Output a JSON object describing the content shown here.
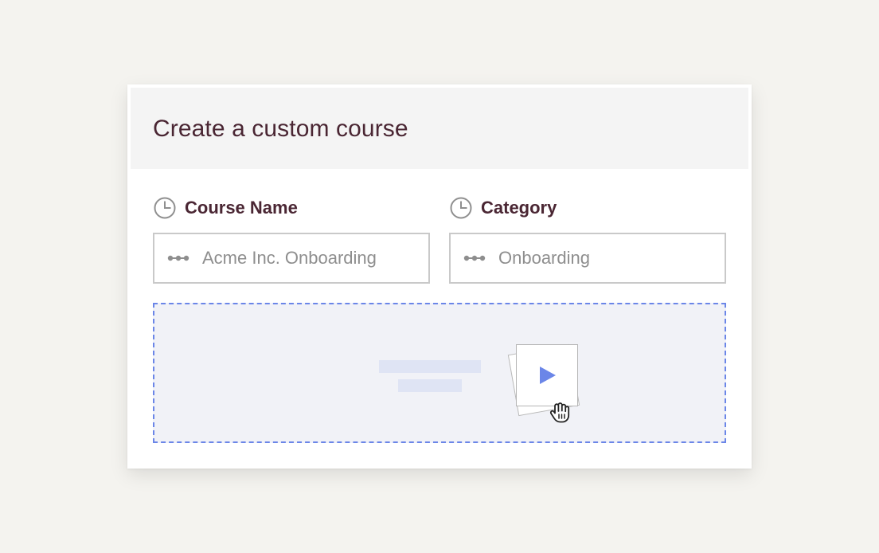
{
  "card": {
    "title": "Create a custom course"
  },
  "fields": [
    {
      "label": "Course Name",
      "icon": "clock-icon",
      "value": "",
      "placeholder": "Acme Inc. Onboarding"
    },
    {
      "label": "Category",
      "icon": "clock-icon",
      "value": "",
      "placeholder": "Onboarding"
    }
  ],
  "dropzone": {
    "icons": [
      "play-icon",
      "hand-cursor-icon"
    ]
  },
  "colors": {
    "page_background": "#f4f3ef",
    "title_text": "#4a2633",
    "placeholder_text": "#8e8e8e",
    "field_border": "#c9c9c9",
    "dropzone_border": "#6b86e8",
    "dropzone_fill": "#f1f2f7",
    "accent_play": "#6b86e8"
  }
}
